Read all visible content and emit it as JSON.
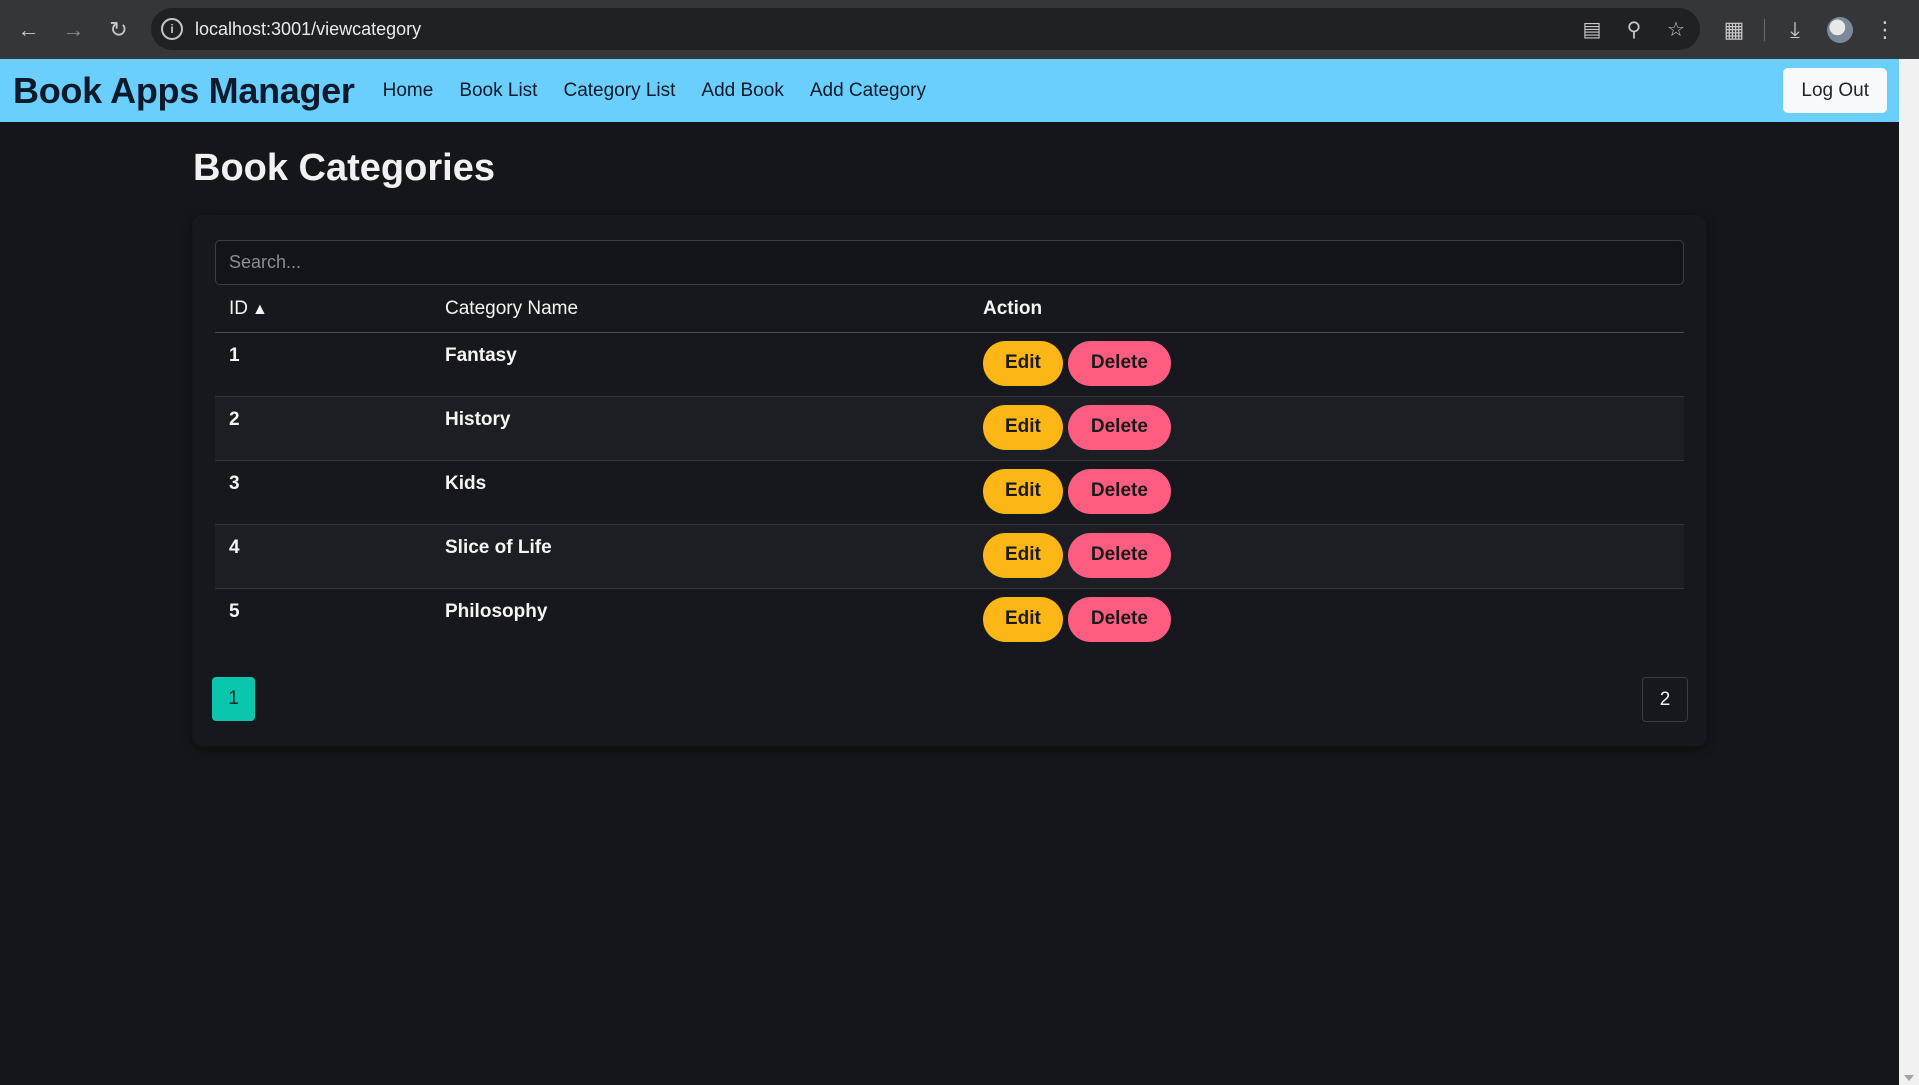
{
  "browser": {
    "url": "localhost:3001/viewcategory"
  },
  "navbar": {
    "brand": "Book Apps Manager",
    "links": [
      "Home",
      "Book List",
      "Category List",
      "Add Book",
      "Add Category"
    ],
    "logout_label": "Log Out",
    "bg_color": "#6acffd"
  },
  "page": {
    "title": "Book Categories",
    "search_placeholder": "Search...",
    "table": {
      "headers": {
        "id": "ID",
        "name": "Category Name",
        "action": "Action"
      },
      "sort_indicator": "▲",
      "rows": [
        {
          "id": "1",
          "name": "Fantasy"
        },
        {
          "id": "2",
          "name": "History"
        },
        {
          "id": "3",
          "name": "Kids"
        },
        {
          "id": "4",
          "name": "Slice of Life"
        },
        {
          "id": "5",
          "name": "Philosophy"
        }
      ],
      "edit_label": "Edit",
      "delete_label": "Delete"
    },
    "pagination": {
      "current": "1",
      "next": "2"
    },
    "colors": {
      "edit": "#fcb716",
      "delete": "#fe5d81",
      "active_page": "#09c6ad"
    }
  }
}
